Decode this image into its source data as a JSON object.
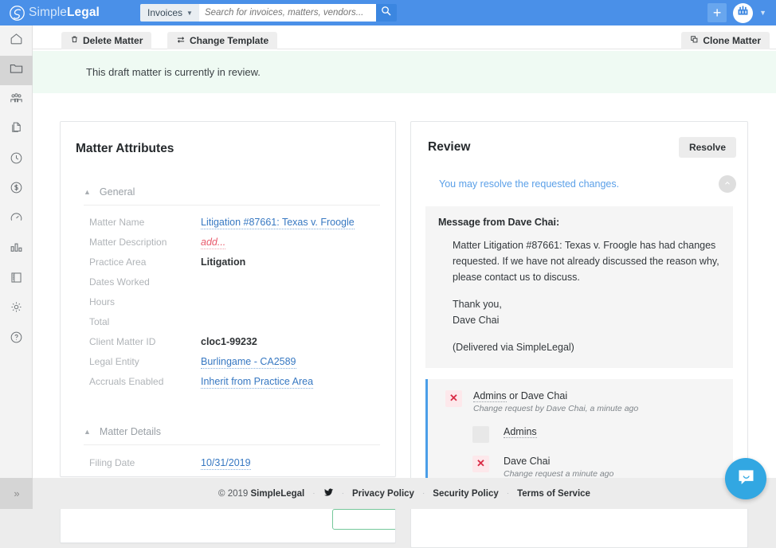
{
  "topbar": {
    "brand_light": "Simple",
    "brand_bold": "Legal",
    "brand_logo_icon": "simplelegal-swirl-logo-icon",
    "search": {
      "scope_label": "Invoices",
      "scope_chevron_icon": "chevron-down-icon",
      "placeholder": "Search for invoices, matters, vendors...",
      "value": "",
      "search_icon": "search-icon"
    },
    "add_button_label": "+",
    "add_button_icon": "plus-icon",
    "avatar_icon": "company-avatar-icon",
    "account_chevron_icon": "chevron-down-icon"
  },
  "sidebar": {
    "items": [
      {
        "name": "home",
        "icon": "home-icon",
        "active": false
      },
      {
        "name": "matters",
        "icon": "folder-icon",
        "active": true
      },
      {
        "name": "vendors",
        "icon": "people-group-icon",
        "active": false
      },
      {
        "name": "documents",
        "icon": "documents-icon",
        "active": false
      },
      {
        "name": "time",
        "icon": "clock-icon",
        "active": false
      },
      {
        "name": "budgets",
        "icon": "dollar-circle-icon",
        "active": false
      },
      {
        "name": "analytics",
        "icon": "gauge-icon",
        "active": false
      },
      {
        "name": "reports",
        "icon": "bar-chart-icon",
        "active": false
      },
      {
        "name": "library",
        "icon": "notebook-icon",
        "active": false
      },
      {
        "name": "settings",
        "icon": "gear-icon",
        "active": false
      },
      {
        "name": "help",
        "icon": "question-circle-icon",
        "active": false
      }
    ],
    "expand_label": "»",
    "expand_icon": "double-chevron-right-icon"
  },
  "tabs": [
    {
      "label": "Delete Matter",
      "icon": "trash-icon"
    },
    {
      "label": "Change Template",
      "icon": "swap-arrows-icon"
    },
    {
      "label": "Clone Matter",
      "icon": "clone-icon"
    }
  ],
  "alert": {
    "text": "This draft matter is currently in review.",
    "background_color": "#effaf3"
  },
  "matter_attributes": {
    "title": "Matter Attributes",
    "sections": [
      {
        "heading": "General",
        "chevron_icon": "chevron-up-icon",
        "rows": [
          {
            "label": "Matter Name",
            "value": "Litigation #87661: Texas v. Froogle",
            "style": "link"
          },
          {
            "label": "Matter Description",
            "value": "add...",
            "style": "add-link"
          },
          {
            "label": "Practice Area",
            "value": "Litigation",
            "style": "bold"
          },
          {
            "label": "Dates Worked",
            "value": "",
            "style": "plain"
          },
          {
            "label": "Hours",
            "value": "",
            "style": "plain"
          },
          {
            "label": "Total",
            "value": "",
            "style": "plain"
          },
          {
            "label": "Client Matter ID",
            "value": "cloc1-99232",
            "style": "bold"
          },
          {
            "label": "Legal Entity",
            "value": "Burlingame - CA2589",
            "style": "link"
          },
          {
            "label": "Accruals Enabled",
            "value": "Inherit from Practice Area",
            "style": "link"
          }
        ]
      },
      {
        "heading": "Matter Details",
        "chevron_icon": "chevron-up-icon",
        "rows": [
          {
            "label": "Filing Date",
            "value": "10/31/2019",
            "style": "link"
          }
        ]
      }
    ]
  },
  "review": {
    "title": "Review",
    "resolve_label": "Resolve",
    "sub_link": "You may resolve the requested changes.",
    "collapse_icon": "chevron-up-icon",
    "message": {
      "title": "Message from Dave Chai:",
      "paragraphs": [
        "Matter Litigation #87661: Texas v. Froogle has had changes requested. If we have not already discussed the reason why, please contact us to discuss.",
        "Thank you,\nDave Chai",
        "(Delivered via SimpleLegal)"
      ]
    },
    "approval": {
      "accent_color": "#4a9ee8",
      "primary": {
        "badge_icon": "red-x-icon",
        "name_linked": "Admins",
        "name_rest": " or Dave Chai",
        "meta": "Change request by Dave Chai, a minute ago"
      },
      "sub_items": [
        {
          "badge_icon": "empty-checkbox-icon",
          "name": "Admins",
          "meta": "",
          "state": "pending"
        },
        {
          "badge_icon": "red-x-icon",
          "name": "Dave Chai",
          "meta": "Change request a minute ago",
          "state": "rejected"
        }
      ]
    }
  },
  "footer": {
    "copyright_prefix": "© 2019 ",
    "copyright_brand": "SimpleLegal",
    "twitter_icon": "twitter-bird-icon",
    "links": [
      "Privacy Policy",
      "Security Policy",
      "Terms of Service"
    ],
    "separator": "·"
  },
  "chat": {
    "icon": "chat-bubble-smile-icon",
    "color": "#32a7e2"
  }
}
